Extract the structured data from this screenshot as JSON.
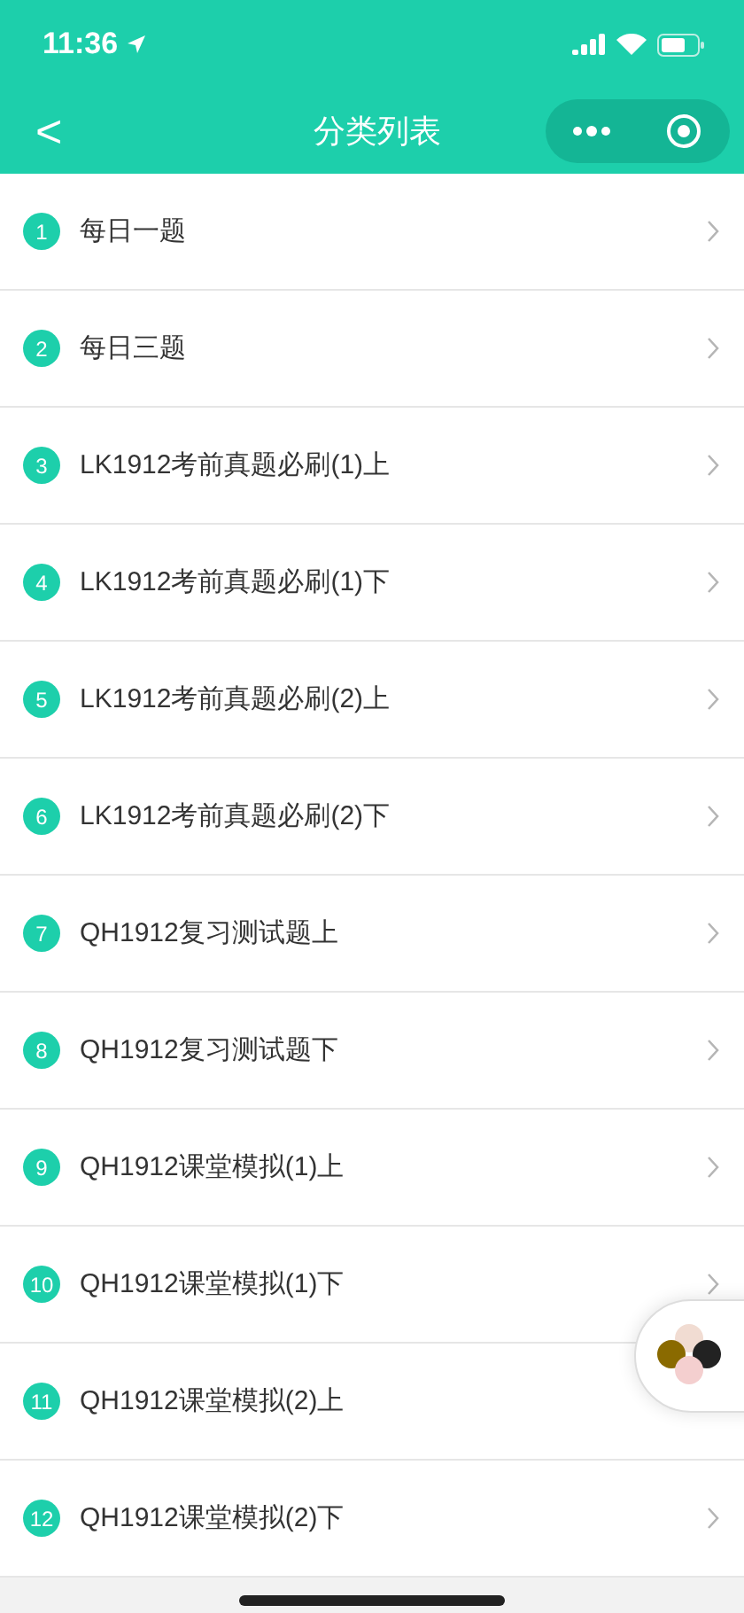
{
  "status_bar": {
    "time": "11:36"
  },
  "nav_bar": {
    "back": "<",
    "title": "分类列表"
  },
  "items": [
    {
      "number": "1",
      "label": "每日一题"
    },
    {
      "number": "2",
      "label": "每日三题"
    },
    {
      "number": "3",
      "label": "LK1912考前真题必刷(1)上"
    },
    {
      "number": "4",
      "label": "LK1912考前真题必刷(1)下"
    },
    {
      "number": "5",
      "label": "LK1912考前真题必刷(2)上"
    },
    {
      "number": "6",
      "label": "LK1912考前真题必刷(2)下"
    },
    {
      "number": "7",
      "label": "QH1912复习测试题上"
    },
    {
      "number": "8",
      "label": "QH1912复习测试题下"
    },
    {
      "number": "9",
      "label": "QH1912课堂模拟(1)上"
    },
    {
      "number": "10",
      "label": "QH1912课堂模拟(1)下"
    },
    {
      "number": "11",
      "label": "QH1912课堂模拟(2)上"
    },
    {
      "number": "12",
      "label": "QH1912课堂模拟(2)下"
    }
  ]
}
